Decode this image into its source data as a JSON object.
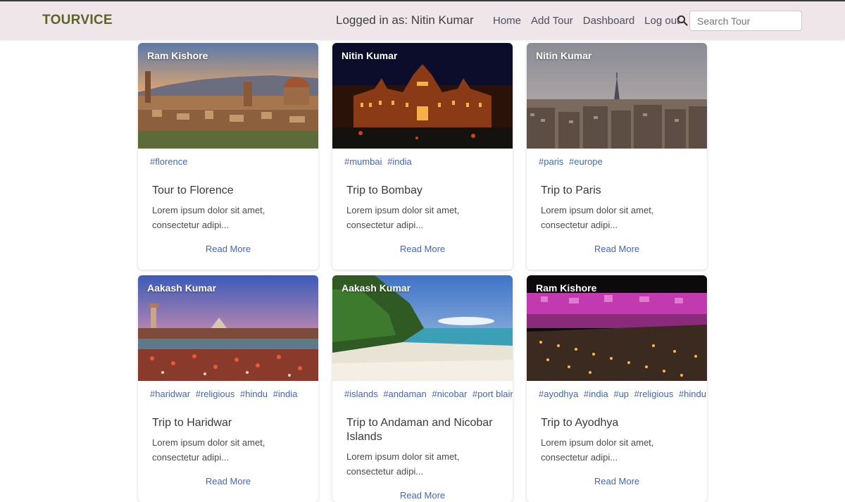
{
  "navbar": {
    "brand": "TOURVICE",
    "logged_in": "Logged in as: Nitin Kumar",
    "links": [
      "Home",
      "Add Tour",
      "Dashboard",
      "Log out"
    ],
    "search_placeholder": "Search Tour"
  },
  "cards": [
    {
      "author": "Ram Kishore",
      "tags": [
        "#florence"
      ],
      "title": "Tour to Florence",
      "text": "Lorem ipsum dolor sit amet, consectetur adipi...",
      "link": "Read More"
    },
    {
      "author": "Nitin Kumar",
      "tags": [
        "#mumbai",
        "#india"
      ],
      "title": "Trip to Bombay",
      "text": "Lorem ipsum dolor sit amet, consectetur adipi...",
      "link": "Read More"
    },
    {
      "author": "Nitin Kumar",
      "tags": [
        "#paris",
        "#europe"
      ],
      "title": "Trip to Paris",
      "text": "Lorem ipsum dolor sit amet, consectetur adipi...",
      "link": "Read More"
    },
    {
      "author": "Aakash Kumar",
      "tags": [
        "#haridwar",
        "#religious",
        "#hindu",
        "#india"
      ],
      "title": "Trip to Haridwar",
      "text": "Lorem ipsum dolor sit amet, consectetur adipi...",
      "link": "Read More"
    },
    {
      "author": "Aakash Kumar",
      "tags": [
        "#islands",
        "#andaman",
        "#nicobar",
        "#port blair"
      ],
      "title": "Trip to Andaman and Nicobar Islands",
      "text": "Lorem ipsum dolor sit amet, consectetur adipi...",
      "link": "Read More"
    },
    {
      "author": "Ram Kishore",
      "tags": [
        "#ayodhya",
        "#india",
        "#up",
        "#religious",
        "#hindu"
      ],
      "title": "Trip to Ayodhya",
      "text": "Lorem ipsum dolor sit amet, consectetur adipi...",
      "link": "Read More"
    }
  ],
  "colors": {
    "navbar_bg": "#efe6ea",
    "brand": "#5c6328",
    "link_blue": "#3f66c6"
  }
}
